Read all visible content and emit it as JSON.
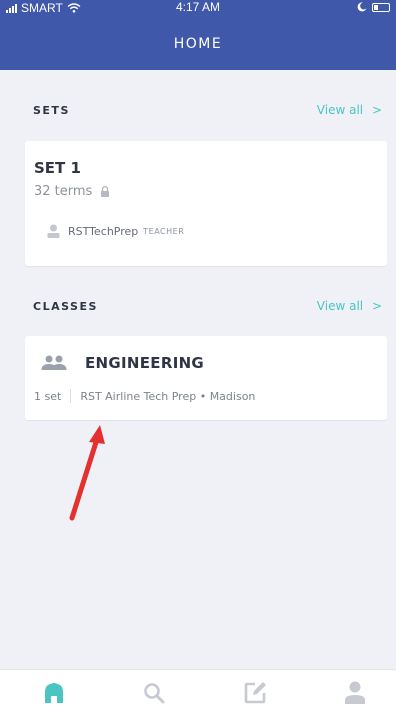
{
  "status_bar": {
    "carrier": "SMART",
    "time": "4:17 AM"
  },
  "header": {
    "title": "HOME"
  },
  "sets_section": {
    "title": "SETS",
    "view_all": "View all",
    "view_all_chevron": ">",
    "card": {
      "title": "SET 1",
      "terms": "32 terms",
      "author": "RSTTechPrep",
      "author_role": "TEACHER"
    }
  },
  "classes_section": {
    "title": "CLASSES",
    "view_all": "View all",
    "view_all_chevron": ">",
    "card": {
      "title": "ENGINEERING",
      "sets_count": "1 set",
      "school": "RST Airline Tech Prep • Madison"
    }
  },
  "tab_bar": {
    "active_tab": "home",
    "tabs": [
      {
        "icon": "home-icon"
      },
      {
        "icon": "search-icon"
      },
      {
        "icon": "create-icon"
      },
      {
        "icon": "profile-icon"
      }
    ]
  },
  "colors": {
    "header_bg": "#3f58aa",
    "accent": "#4bc5c3",
    "page_bg": "#eff1f6",
    "arrow": "#e53030"
  }
}
